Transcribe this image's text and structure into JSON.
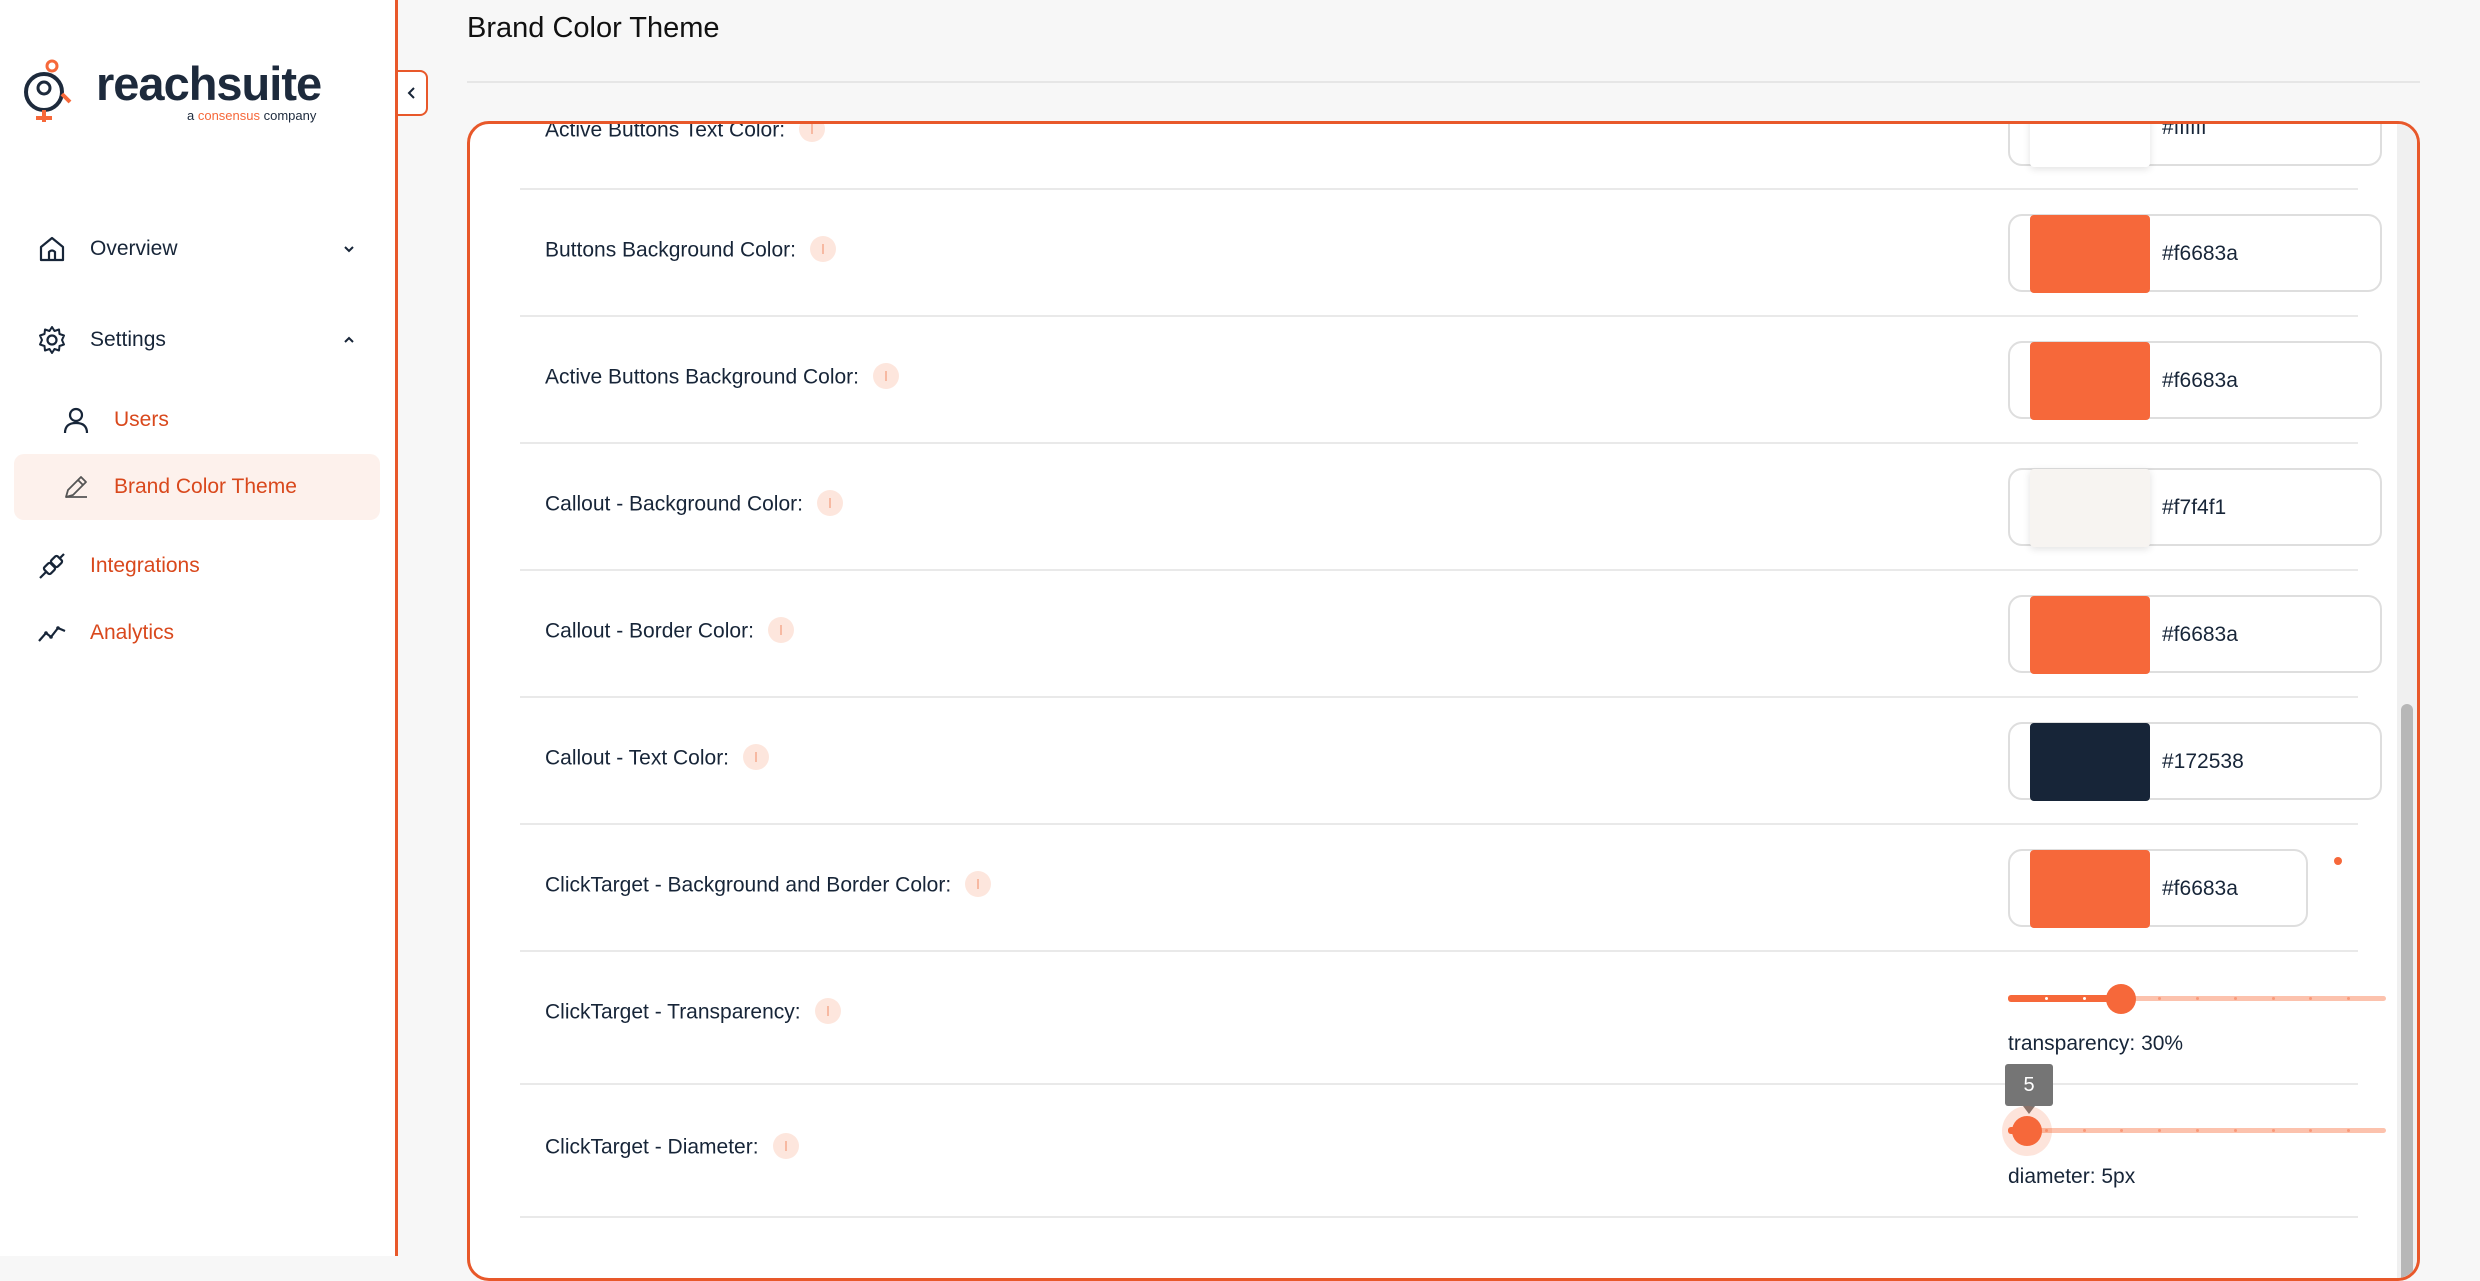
{
  "brand": {
    "name": "reachsuite",
    "tagline_prefix": "a ",
    "tagline_accent": "consensus",
    "tagline_suffix": " company",
    "accent_color": "#f6683a",
    "border_color": "#e8582a",
    "text_color": "#172538"
  },
  "sidebar": {
    "items": [
      {
        "label": "Overview",
        "icon": "home-icon",
        "chevron": "chevron-down-icon"
      },
      {
        "label": "Settings",
        "icon": "gear-icon",
        "chevron": "chevron-up-icon"
      },
      {
        "label": "Users",
        "icon": "user-icon"
      },
      {
        "label": "Brand Color Theme",
        "icon": "pencil-icon",
        "active": true
      },
      {
        "label": "Integrations",
        "icon": "plug-icon"
      },
      {
        "label": "Analytics",
        "icon": "trend-line-icon"
      }
    ]
  },
  "page": {
    "title": "Brand Color Theme"
  },
  "settings": {
    "rows": [
      {
        "label": "Active Buttons Text Color:",
        "value": "#ffffff",
        "swatch": "#ffffff"
      },
      {
        "label": "Buttons Background Color:",
        "value": "#f6683a",
        "swatch": "#f6683a"
      },
      {
        "label": "Active Buttons Background Color:",
        "value": "#f6683a",
        "swatch": "#f6683a"
      },
      {
        "label": "Callout - Background Color:",
        "value": "#f7f4f1",
        "swatch": "#f7f4f1"
      },
      {
        "label": "Callout - Border Color:",
        "value": "#f6683a",
        "swatch": "#f6683a"
      },
      {
        "label": "Callout - Text Color:",
        "value": "#172538",
        "swatch": "#172538"
      },
      {
        "label": "ClickTarget - Background and Border Color:",
        "value": "#f6683a",
        "swatch": "#f6683a"
      }
    ],
    "transparency": {
      "label": "ClickTarget - Transparency:",
      "caption": "transparency: 30%",
      "percent": 30
    },
    "diameter": {
      "label": "ClickTarget - Diameter:",
      "caption": "diameter: 5px",
      "tooltip": "5",
      "fraction": 0.05
    }
  }
}
